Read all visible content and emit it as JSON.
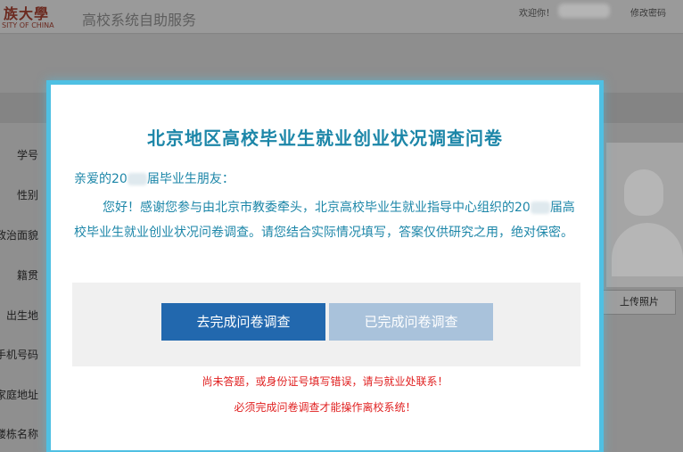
{
  "header": {
    "logo_cn": "族大學",
    "logo_en": "SITY OF CHINA",
    "system_title": "高校系统自助服务",
    "welcome": "欢迎你！",
    "change_password": "修改密码"
  },
  "form": {
    "labels": [
      "学号",
      "性别",
      "政治面貌",
      "籍贯",
      "出生地",
      "手机号码",
      "家庭地址",
      "楼栋名称"
    ],
    "upload_photo": "上传照片"
  },
  "modal": {
    "title": "北京地区高校毕业生就业创业状况调查问卷",
    "greeting_prefix": "亲爱的20",
    "greeting_suffix": "届毕业生朋友：",
    "para_part1": "您好！感谢您参与由北京市教委牵头，北京高校毕业生就业指导中心组织的20",
    "para_part2": "届高校毕业生就业创业状况问卷调查。请您结合实际情况填写，答案仅供研究之用，绝对保密。",
    "primary_button": "去完成问卷调查",
    "completed_button": "已完成问卷调查",
    "warning_1": "尚未答题，或身份证号填写错误，请与就业处联系！",
    "warning_2": "必须完成问卷调查才能操作离校系统！"
  },
  "colors": {
    "modal_border": "#4fc0e3",
    "title_text": "#1c86a8",
    "primary_button": "#2268ae",
    "disabled_button": "#a9c2db",
    "warning_text": "#e02020"
  }
}
